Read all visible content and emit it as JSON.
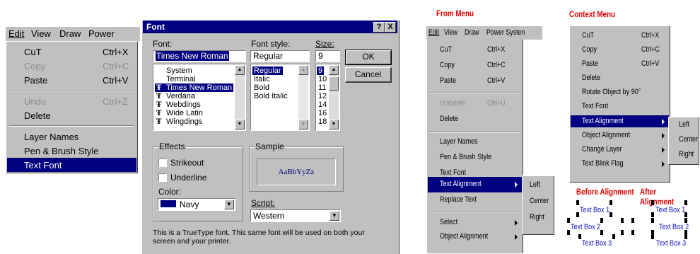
{
  "panel1": {
    "menubar": [
      "Edit",
      "View",
      "Draw",
      "Power System"
    ],
    "items": [
      {
        "label": "CuT",
        "accel": "Ctrl+X",
        "state": "normal"
      },
      {
        "label": "Copy",
        "accel": "Ctrl+C",
        "state": "disabled"
      },
      {
        "label": "Paste",
        "accel": "Ctrl+V",
        "state": "normal"
      },
      {
        "label": "Undo",
        "accel": "Ctrl+Z",
        "state": "disabled"
      },
      {
        "label": "Delete",
        "accel": "",
        "state": "normal"
      },
      {
        "label": "Layer Names",
        "accel": "",
        "state": "normal"
      },
      {
        "label": "Pen & Brush Style",
        "accel": "",
        "state": "normal"
      },
      {
        "label": "Text Font",
        "accel": "",
        "state": "selected"
      }
    ]
  },
  "font_dialog": {
    "title": "Font",
    "help_btn": "?",
    "close_btn": "X",
    "font_label": "Font:",
    "font_value": "Times New Roman",
    "font_list": [
      "System",
      "Terminal",
      "Times New Roman",
      "Verdana",
      "Webdings",
      "Wide Latin",
      "Wingdings"
    ],
    "font_selected": "Times New Roman",
    "style_label": "Font style:",
    "style_value": "Regular",
    "style_list": [
      "Regular",
      "Italic",
      "Bold",
      "Bold Italic"
    ],
    "size_label": "Size:",
    "size_value": "9",
    "size_list": [
      "9",
      "10",
      "11",
      "12",
      "14",
      "16",
      "18"
    ],
    "ok": "OK",
    "cancel": "Cancel",
    "effects_label": "Effects",
    "strikeout": "Strikeout",
    "underline": "Underline",
    "color_label": "Color:",
    "color_value": "Navy",
    "color_swatch": "#000080",
    "sample_label": "Sample",
    "sample_text": "AaBbYyZz",
    "script_label": "Script:",
    "script_value": "Western",
    "footer": "This is a TrueType font. This same font will be used on both your screen and your printer."
  },
  "panel3": {
    "heading": "From Menu",
    "menubar": [
      "Edit",
      "View",
      "Draw",
      "Power Systen"
    ],
    "items": [
      {
        "label": "CuT",
        "accel": "Ctrl+X",
        "state": "normal"
      },
      {
        "label": "Copy",
        "accel": "Ctrl+C",
        "state": "normal"
      },
      {
        "label": "Paste",
        "accel": "Ctrl+V",
        "state": "normal"
      },
      {
        "label": "Undelete",
        "accel": "Ctrl+U",
        "state": "disabled"
      },
      {
        "label": "Delete",
        "accel": "",
        "state": "normal"
      },
      {
        "label": "Layer Names",
        "accel": "",
        "state": "normal"
      },
      {
        "label": "Pen & Brush Style",
        "accel": "",
        "state": "normal"
      },
      {
        "label": "Text Font",
        "accel": "",
        "state": "normal"
      },
      {
        "label": "Text Alignment",
        "accel": "",
        "state": "selected"
      },
      {
        "label": "Replace Text",
        "accel": "",
        "state": "normal"
      },
      {
        "label": "Select",
        "accel": "",
        "state": "normal"
      },
      {
        "label": "Object Alignment",
        "accel": "",
        "state": "normal"
      }
    ],
    "submenu": [
      "Left",
      "Center",
      "Right"
    ]
  },
  "panel4": {
    "heading": "Context Menu",
    "items": [
      {
        "label": "CuT",
        "accel": "Ctrl+X",
        "state": "normal"
      },
      {
        "label": "Copy",
        "accel": "Ctrl+C",
        "state": "normal"
      },
      {
        "label": "Paste",
        "accel": "Ctrl+V",
        "state": "normal"
      },
      {
        "label": "Delete",
        "accel": "",
        "state": "normal"
      },
      {
        "label": "Rotate Object by 90°",
        "accel": "",
        "state": "normal"
      },
      {
        "label": "Text Font",
        "accel": "",
        "state": "normal"
      },
      {
        "label": "Text Alignment",
        "accel": "",
        "state": "selected"
      },
      {
        "label": "Object Alignment",
        "accel": "",
        "state": "normal"
      },
      {
        "label": "Change Layer",
        "accel": "",
        "state": "normal"
      },
      {
        "label": "Text Blink Flag",
        "accel": "",
        "state": "normal"
      }
    ],
    "submenu": [
      "Left",
      "Center",
      "Right"
    ],
    "before_label": "Before Alignment",
    "after_label": "After Alignment",
    "before_boxes": [
      "Text Box 1",
      "Text Box 2",
      "Text Box 3"
    ],
    "after_boxes": [
      "Text Box 1",
      "Text Box 2",
      "Text Box 3"
    ]
  }
}
